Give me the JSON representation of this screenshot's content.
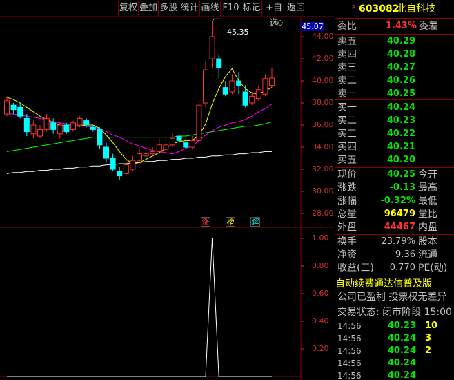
{
  "colors": {
    "up": "#ff3232",
    "down": "#00ffff",
    "flat": "#ffffff",
    "ma5": "#ffff00",
    "ma10": "#ff00ff",
    "ma20": "#00ff00",
    "ma60": "#ffffff",
    "green_val": "#00e600",
    "red_val": "#ff3232",
    "yellow_val": "#ffff00"
  },
  "toolbar": {
    "items": [
      "复权",
      "叠加",
      "多股",
      "统计",
      "画线",
      "F10",
      "标记",
      "+自选",
      "返回"
    ]
  },
  "chart": {
    "current_price_tag": "45.07",
    "peak_label": "45.35",
    "price_ticks": [
      "44.00",
      "42.00",
      "40.00",
      "38.00",
      "36.00",
      "34.00",
      "32.00",
      "30.00",
      "28.00"
    ],
    "indicator_ticks": [
      "1.00",
      "0.80",
      "0.60",
      "0.40",
      "0.20"
    ],
    "tags": [
      {
        "text": "涨",
        "color": "#ff4040"
      },
      {
        "text": "榜",
        "color": "#ffff00"
      },
      {
        "text": "解",
        "color": "#00ffff"
      }
    ],
    "diamond": "◇"
  },
  "chart_data": {
    "type": "candlestick",
    "ylim": [
      27,
      47
    ],
    "candles": [
      {
        "o": 37.0,
        "c": 38.2,
        "h": 38.6,
        "l": 36.8
      },
      {
        "o": 37.8,
        "c": 37.4,
        "h": 38.0,
        "l": 37.0
      },
      {
        "o": 37.6,
        "c": 36.8,
        "h": 38.0,
        "l": 36.6
      },
      {
        "o": 36.6,
        "c": 35.4,
        "h": 37.0,
        "l": 35.0
      },
      {
        "o": 35.2,
        "c": 36.0,
        "h": 36.4,
        "l": 34.8
      },
      {
        "o": 35.0,
        "c": 35.6,
        "h": 36.0,
        "l": 34.8
      },
      {
        "o": 35.6,
        "c": 36.6,
        "h": 37.0,
        "l": 35.4
      },
      {
        "o": 36.2,
        "c": 35.6,
        "h": 36.6,
        "l": 35.2
      },
      {
        "o": 35.2,
        "c": 36.0,
        "h": 36.2,
        "l": 34.8
      },
      {
        "o": 36.0,
        "c": 35.4,
        "h": 36.2,
        "l": 35.2
      },
      {
        "o": 35.6,
        "c": 36.2,
        "h": 36.4,
        "l": 35.4
      },
      {
        "o": 36.0,
        "c": 36.6,
        "h": 36.8,
        "l": 35.8
      },
      {
        "o": 36.4,
        "c": 36.0,
        "h": 36.6,
        "l": 35.8
      },
      {
        "o": 35.8,
        "c": 35.6,
        "h": 36.0,
        "l": 35.4
      },
      {
        "o": 35.6,
        "c": 34.2,
        "h": 35.8,
        "l": 33.8
      },
      {
        "o": 34.0,
        "c": 33.0,
        "h": 34.4,
        "l": 32.6
      },
      {
        "o": 33.0,
        "c": 32.0,
        "h": 33.4,
        "l": 31.8
      },
      {
        "o": 31.8,
        "c": 31.4,
        "h": 32.2,
        "l": 31.0
      },
      {
        "o": 31.6,
        "c": 32.4,
        "h": 32.8,
        "l": 31.4
      },
      {
        "o": 32.0,
        "c": 32.8,
        "h": 33.2,
        "l": 31.8
      },
      {
        "o": 32.8,
        "c": 33.4,
        "h": 34.0,
        "l": 32.6
      },
      {
        "o": 33.2,
        "c": 33.4,
        "h": 34.2,
        "l": 33.0
      },
      {
        "o": 33.4,
        "c": 33.6,
        "h": 34.0,
        "l": 33.2
      },
      {
        "o": 33.6,
        "c": 34.2,
        "h": 34.8,
        "l": 33.4
      },
      {
        "o": 33.8,
        "c": 34.2,
        "h": 35.2,
        "l": 33.4
      },
      {
        "o": 34.2,
        "c": 34.8,
        "h": 35.2,
        "l": 34.0
      },
      {
        "o": 35.0,
        "c": 34.6,
        "h": 35.2,
        "l": 34.2
      },
      {
        "o": 34.4,
        "c": 34.0,
        "h": 34.8,
        "l": 33.8
      },
      {
        "o": 34.0,
        "c": 34.6,
        "h": 35.0,
        "l": 33.8
      },
      {
        "o": 34.6,
        "c": 37.8,
        "h": 38.4,
        "l": 34.4
      },
      {
        "o": 38.0,
        "c": 41.0,
        "h": 41.8,
        "l": 37.6
      },
      {
        "o": 42.0,
        "c": 44.0,
        "h": 45.35,
        "l": 41.2
      },
      {
        "o": 42.0,
        "c": 41.2,
        "h": 42.4,
        "l": 40.2
      },
      {
        "o": 39.4,
        "c": 38.8,
        "h": 40.0,
        "l": 38.6
      },
      {
        "o": 39.0,
        "c": 40.0,
        "h": 40.6,
        "l": 38.8
      },
      {
        "o": 40.0,
        "c": 39.6,
        "h": 40.8,
        "l": 38.8
      },
      {
        "o": 39.0,
        "c": 37.8,
        "h": 39.6,
        "l": 37.6
      },
      {
        "o": 38.0,
        "c": 38.6,
        "h": 39.0,
        "l": 37.8
      },
      {
        "o": 38.4,
        "c": 39.2,
        "h": 39.6,
        "l": 38.2
      },
      {
        "o": 38.8,
        "c": 40.2,
        "h": 40.6,
        "l": 38.6
      },
      {
        "o": 39.6,
        "c": 40.25,
        "h": 41.2,
        "l": 39.4
      }
    ],
    "ma5": [
      38.5,
      38.3,
      38.0,
      37.6,
      37.2,
      36.8,
      36.5,
      36.2,
      36.0,
      35.9,
      35.9,
      35.9,
      36.0,
      36.0,
      35.7,
      35.1,
      34.4,
      33.6,
      32.9,
      32.5,
      32.6,
      32.9,
      33.2,
      33.5,
      33.9,
      34.3,
      34.5,
      34.6,
      34.6,
      35.1,
      36.1,
      37.9,
      39.3,
      40.4,
      41.1,
      40.0,
      39.3,
      38.9,
      38.8,
      39.1,
      39.4
    ],
    "ma10": [
      37.0,
      37.0,
      36.9,
      36.8,
      36.7,
      36.6,
      36.5,
      36.3,
      36.2,
      36.1,
      36.0,
      35.9,
      35.9,
      35.8,
      35.7,
      35.4,
      35.1,
      34.9,
      34.6,
      34.3,
      34.1,
      33.9,
      33.7,
      33.6,
      33.5,
      33.4,
      33.6,
      33.9,
      34.1,
      34.6,
      35.1,
      35.5,
      35.8,
      36.0,
      36.2,
      36.3,
      36.5,
      36.8,
      37.2,
      37.5,
      37.9
    ],
    "ma20": [
      33.6,
      33.7,
      33.8,
      33.9,
      34.0,
      34.1,
      34.2,
      34.3,
      34.4,
      34.5,
      34.6,
      34.7,
      34.8,
      34.9,
      34.9,
      34.9,
      34.9,
      34.9,
      34.9,
      34.9,
      34.9,
      34.9,
      34.9,
      34.9,
      34.9,
      34.9,
      35.0,
      35.0,
      35.1,
      35.2,
      35.3,
      35.4,
      35.5,
      35.6,
      35.7,
      35.8,
      35.9,
      35.9,
      36.0,
      36.1,
      36.3
    ],
    "ma60": [
      31.6,
      31.7,
      31.7,
      31.8,
      31.8,
      31.9,
      31.9,
      32.0,
      32.0,
      32.1,
      32.1,
      32.2,
      32.2,
      32.3,
      32.3,
      32.4,
      32.4,
      32.5,
      32.5,
      32.6,
      32.6,
      32.7,
      32.7,
      32.8,
      32.8,
      32.9,
      32.9,
      33.0,
      33.0,
      33.1,
      33.1,
      33.2,
      33.2,
      33.3,
      33.3,
      33.4,
      33.4,
      33.5,
      33.5,
      33.6,
      33.6
    ],
    "indicator": {
      "ylim": [
        0,
        1.05
      ],
      "values": [
        0,
        0,
        0,
        0,
        0,
        0,
        0,
        0,
        0,
        0,
        0,
        0,
        0,
        0,
        0,
        0,
        0,
        0,
        0,
        0,
        0,
        0,
        0,
        0,
        0,
        0,
        0,
        0,
        0,
        0,
        0,
        1,
        0,
        0,
        0,
        0,
        0,
        0,
        0,
        0,
        0
      ]
    }
  },
  "stock": {
    "badge": "R",
    "code": "603082",
    "name": "北自科技"
  },
  "order_ratio": {
    "label1": "委比",
    "value": "1.43%",
    "label2": "委差"
  },
  "asks": [
    {
      "label": "卖五",
      "price": "40.29"
    },
    {
      "label": "卖四",
      "price": "40.28"
    },
    {
      "label": "卖三",
      "price": "40.27"
    },
    {
      "label": "卖二",
      "price": "40.26"
    },
    {
      "label": "卖一",
      "price": "40.25"
    }
  ],
  "bids": [
    {
      "label": "买一",
      "price": "40.24"
    },
    {
      "label": "买二",
      "price": "40.23"
    },
    {
      "label": "买三",
      "price": "40.22"
    },
    {
      "label": "买四",
      "price": "40.21"
    },
    {
      "label": "买五",
      "price": "40.20"
    }
  ],
  "quote": [
    {
      "label": "现价",
      "value": "40.25",
      "label2": "今开",
      "color": "#00e600"
    },
    {
      "label": "涨跌",
      "value": "-0.13",
      "label2": "最高",
      "color": "#00e600"
    },
    {
      "label": "涨幅",
      "value": "-0.32%",
      "label2": "最低",
      "color": "#00e600"
    },
    {
      "label": "总量",
      "value": "96479",
      "label2": "量比",
      "color": "#ffff00"
    },
    {
      "label": "外盘",
      "value": "44467",
      "label2": "内盘",
      "color": "#ff3232"
    }
  ],
  "stats": [
    {
      "label": "换手",
      "value": "23.79%",
      "label2": "股本"
    },
    {
      "label": "净资",
      "value": "9.36",
      "label2": "流通"
    },
    {
      "label": "收益(三)",
      "value": "0.770",
      "label2": "PE(动)"
    }
  ],
  "notice": {
    "line1": "自动续费通达信普及版",
    "line2": "公司已盈利 投票权无差异"
  },
  "trade_status": "交易状态: 闭市阶段 15:00",
  "ticks": [
    {
      "time": "14:56",
      "price": "40.23",
      "vol": "10"
    },
    {
      "time": "14:56",
      "price": "40.24",
      "vol": "3"
    },
    {
      "time": "14:56",
      "price": "40.24",
      "vol": "2"
    },
    {
      "time": "14:56",
      "price": "40.24",
      "vol": ""
    },
    {
      "time": "14:56",
      "price": "40.24",
      "vol": ""
    }
  ]
}
